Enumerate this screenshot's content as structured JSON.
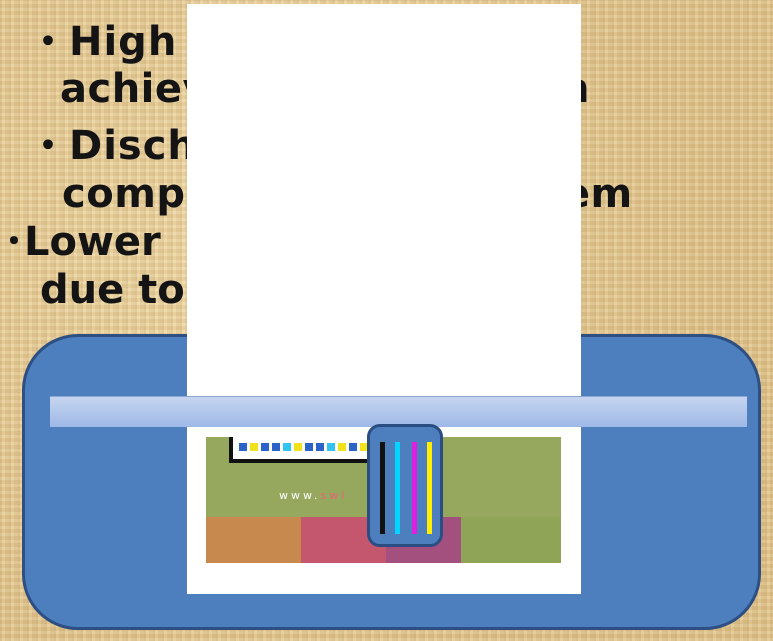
{
  "slide_text": {
    "line1": "・High c",
    "line2": "achiev               system",
    "line3": "・Discha",
    "line4": "compa               s system",
    "line5": "･Lower               d printer",
    "line6": "due to"
  },
  "print_sample": {
    "url_prefix": "www.",
    "url_accent": "swi"
  },
  "colors": {
    "background": "#e6cd97",
    "printer_body": "#4d7fbe",
    "printer_outline": "#2d4f83",
    "rail": "#b5c9ec",
    "paper": "#ffffff",
    "ink_black": "#111111",
    "ink_cyan": "#00d5ff",
    "ink_magenta": "#e020e0",
    "ink_yellow": "#ffee00"
  },
  "ink_cartridges": [
    "black",
    "cyan",
    "magenta",
    "yellow"
  ],
  "sample_swatches": [
    "blue",
    "yellow",
    "blue",
    "blue",
    "cyan",
    "yellow",
    "blue",
    "blue",
    "cyan",
    "yellow",
    "blue",
    "yellow"
  ],
  "sample_blocks": [
    "orange",
    "pink",
    "purple",
    "olive"
  ]
}
